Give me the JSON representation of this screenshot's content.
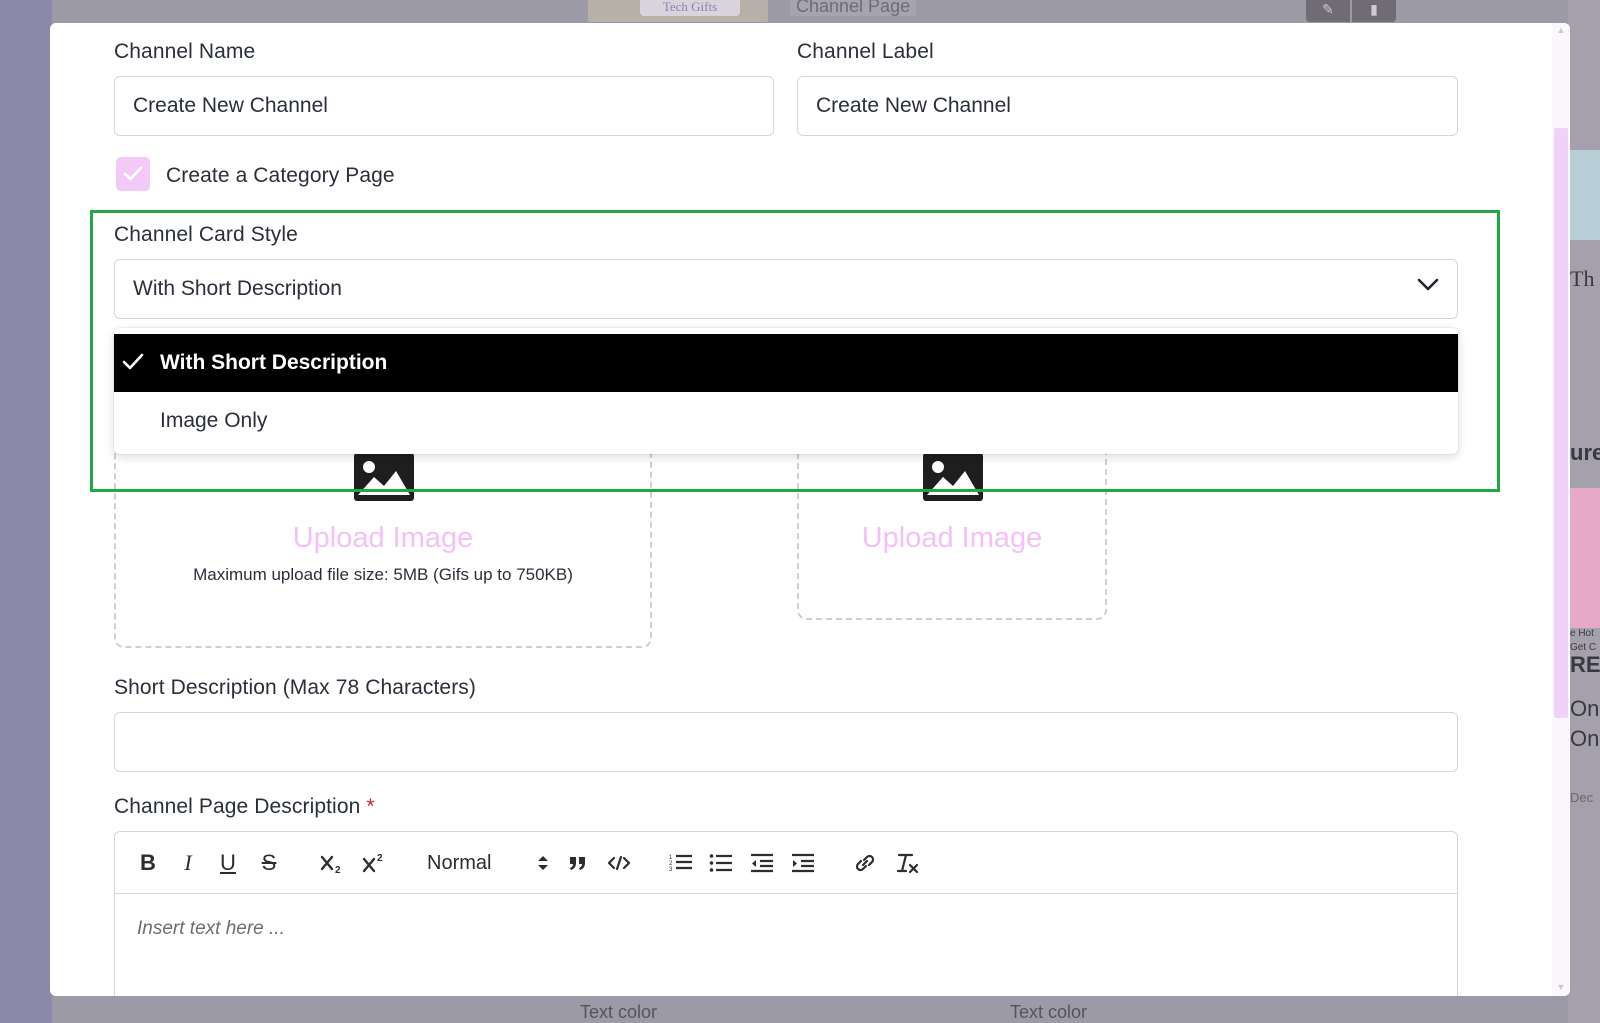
{
  "background": {
    "thumb_label": "Tech Gifts",
    "channel_page_label": "Channel Page",
    "text_color_label_1": "Text color",
    "text_color_label_2": "Text color",
    "right_strip": {
      "text_1": "Th",
      "text_2": "ure",
      "text_3": "e Hot",
      "text_4": "Get C",
      "text_5": "REE",
      "text_6": "One",
      "text_7": "One",
      "text_8": "Dec"
    }
  },
  "form": {
    "channel_name": {
      "label": "Channel Name",
      "value": "Create New Channel"
    },
    "channel_label": {
      "label": "Channel Label",
      "value": "Create New Channel"
    },
    "category_page": {
      "label": "Create a Category Page",
      "checked": true
    },
    "card_style": {
      "label": "Channel Card Style",
      "value": "With Short Description",
      "options": [
        {
          "label": "With Short Description",
          "selected": true
        },
        {
          "label": "Image Only",
          "selected": false
        }
      ]
    },
    "upload_1": {
      "label": "Upload Image",
      "note": "Maximum upload file size: 5MB (Gifs up to 750KB)"
    },
    "upload_2": {
      "label": "Upload Image"
    },
    "short_description": {
      "label": "Short Description (Max 78 Characters)",
      "value": ""
    },
    "page_description": {
      "label": "Channel Page Description",
      "required_mark": "*",
      "placeholder": "Insert text here ...",
      "toolbar": {
        "bold": "B",
        "italic": "I",
        "underline": "U",
        "strike": "S",
        "heading_select": "Normal"
      }
    }
  },
  "colors": {
    "accent_pink": "#f3c1f8",
    "highlight_green": "#1fa845",
    "selected_option_bg": "#000000"
  }
}
